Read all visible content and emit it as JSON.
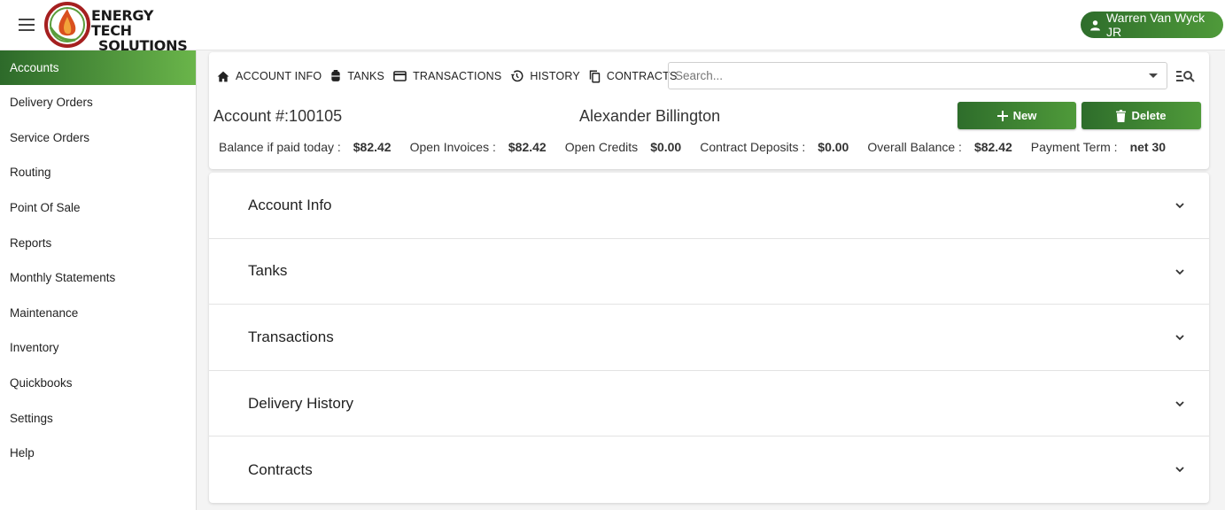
{
  "brand": {
    "line1": "ENERGY TECH",
    "line2": "SOLUTIONS",
    "logo_icon": "flame-drop-logo"
  },
  "topbar": {
    "menu_icon": "hamburger-icon",
    "user_name": "Warren Van Wyck JR",
    "user_icon": "person-icon"
  },
  "colors": {
    "accent_dark": "#2e6d2b",
    "accent_light": "#6ab54a"
  },
  "sidebar": {
    "items": [
      {
        "label": "Accounts",
        "active": true
      },
      {
        "label": "Delivery Orders"
      },
      {
        "label": "Service Orders"
      },
      {
        "label": "Routing"
      },
      {
        "label": "Point Of Sale"
      },
      {
        "label": "Reports"
      },
      {
        "label": "Monthly Statements"
      },
      {
        "label": "Maintenance"
      },
      {
        "label": "Inventory"
      },
      {
        "label": "Quickbooks"
      },
      {
        "label": "Settings"
      },
      {
        "label": "Help"
      }
    ]
  },
  "tabs": [
    {
      "label": "ACCOUNT INFO",
      "icon": "home-icon"
    },
    {
      "label": "TANKS",
      "icon": "tank-icon"
    },
    {
      "label": "TRANSACTIONS",
      "icon": "credit-card-icon"
    },
    {
      "label": "HISTORY",
      "icon": "history-icon"
    },
    {
      "label": "CONTRACTS",
      "icon": "copy-icon"
    }
  ],
  "search": {
    "placeholder": "Search..."
  },
  "account": {
    "number": "Account #:100105",
    "name": "Alexander Billington",
    "new_label": "New",
    "delete_label": "Delete"
  },
  "stats": [
    {
      "label": "Balance if paid today :",
      "value": "$82.42"
    },
    {
      "label": "Open Invoices :",
      "value": "$82.42"
    },
    {
      "label": "Open Credits",
      "value": "$0.00"
    },
    {
      "label": "Contract Deposits :",
      "value": "$0.00"
    },
    {
      "label": "Overall Balance :",
      "value": "$82.42"
    },
    {
      "label": "Payment Term :",
      "value": "net 30"
    }
  ],
  "sections": [
    {
      "label": "Account Info"
    },
    {
      "label": "Tanks"
    },
    {
      "label": "Transactions"
    },
    {
      "label": "Delivery History"
    },
    {
      "label": "Contracts"
    }
  ]
}
